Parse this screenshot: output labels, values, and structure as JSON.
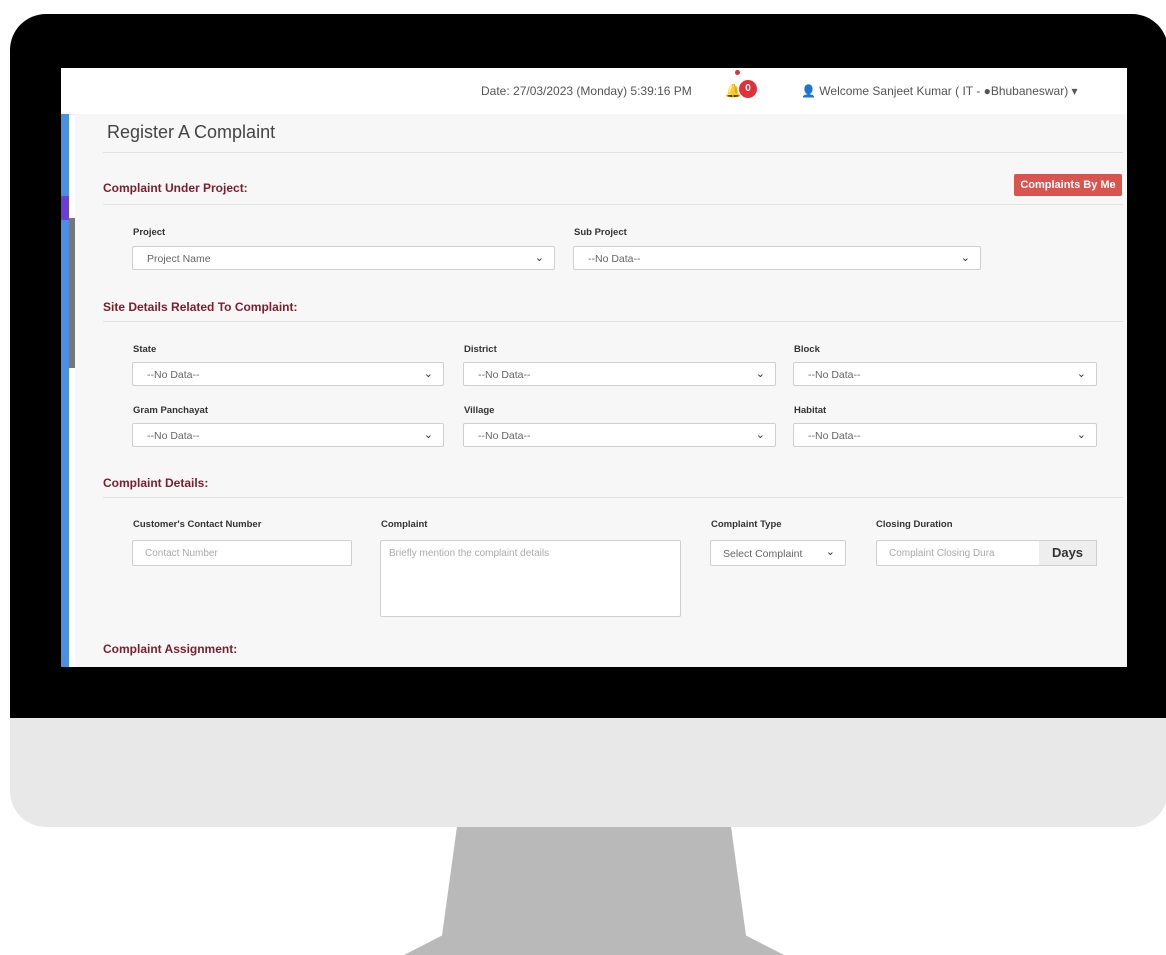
{
  "topbar": {
    "date_text": "Date: 27/03/2023 (Monday) 5:39:16 PM",
    "notification_count": "0",
    "welcome_text": "Welcome Sanjeet Kumar (   IT - ",
    "location_text": "Bhubaneswar) ▾"
  },
  "page": {
    "title": "Register A Complaint"
  },
  "actions": {
    "complaints_by_me": "Complaints By Me"
  },
  "sections": {
    "under_project": "Complaint Under Project:",
    "site_details": "Site Details Related To Complaint:",
    "complaint_details": "Complaint Details:",
    "assignment": "Complaint Assignment:"
  },
  "project": {
    "project_label": "Project",
    "project_value": "Project Name",
    "sub_project_label": "Sub Project",
    "sub_project_value": "--No Data--"
  },
  "site": {
    "state_label": "State",
    "state_value": "--No Data--",
    "district_label": "District",
    "district_value": "--No Data--",
    "block_label": "Block",
    "block_value": "--No Data--",
    "gp_label": "Gram Panchayat",
    "gp_value": "--No Data--",
    "village_label": "Village",
    "village_value": "--No Data--",
    "habitat_label": "Habitat",
    "habitat_value": "--No Data--"
  },
  "details": {
    "contact_label": "Customer's Contact Number",
    "contact_placeholder": "Contact Number",
    "complaint_label": "Complaint",
    "complaint_placeholder": "Briefly mention the complaint details",
    "type_label": "Complaint Type",
    "type_value": "Select Complaint",
    "duration_label": "Closing Duration",
    "duration_placeholder": "Complaint Closing Dura",
    "duration_unit": "Days"
  },
  "colors": {
    "section_heading": "#7a1f2b",
    "danger_button": "#d9534f",
    "sidebar": "#4a90e2",
    "badge": "#e0303a"
  }
}
